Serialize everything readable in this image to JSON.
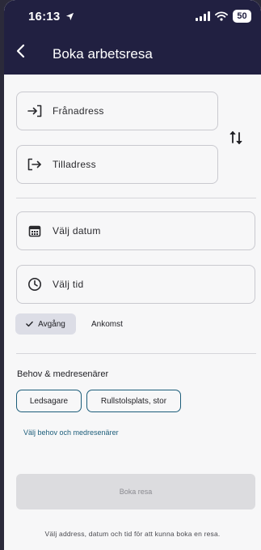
{
  "status_bar": {
    "time": "16:13",
    "battery": "50"
  },
  "header": {
    "title": "Boka arbetsresa"
  },
  "route": {
    "from_placeholder": "Frånadress",
    "to_placeholder": "Tilladress"
  },
  "schedule": {
    "date_placeholder": "Välj datum",
    "time_placeholder": "Välj tid",
    "options": [
      {
        "label": "Avgång",
        "selected": true
      },
      {
        "label": "Ankomst",
        "selected": false
      }
    ]
  },
  "needs": {
    "title": "Behov & medresenärer",
    "chips": [
      "Ledsagare",
      "Rullstolsplats, stor"
    ],
    "link": "Välj behov och medresenärer"
  },
  "actions": {
    "book_label": "Boka resa",
    "hint": "Välj address, datum och tid för att kunna boka en resa."
  },
  "colors": {
    "header_bg": "#212041",
    "accent": "#1c5d7a",
    "page_bg": "#f7f7f8",
    "selected_chip_bg": "#dcdde6",
    "disabled_button_bg": "#dcdcdf"
  }
}
